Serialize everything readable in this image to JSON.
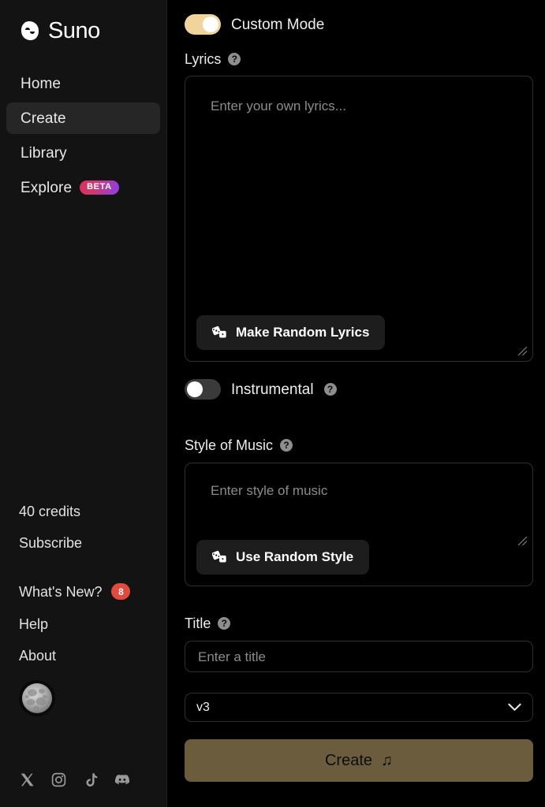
{
  "brand": {
    "name": "Suno",
    "logo_icon": "suno-wave-logo"
  },
  "sidebar": {
    "nav": [
      {
        "label": "Home",
        "icon": "home-nav-item",
        "active": false
      },
      {
        "label": "Create",
        "icon": "create-nav-item",
        "active": true
      },
      {
        "label": "Library",
        "icon": "library-nav-item",
        "active": false
      },
      {
        "label": "Explore",
        "icon": "explore-nav-item",
        "active": false,
        "badge": "BETA"
      }
    ],
    "credits": "40 credits",
    "subscribe": "Subscribe",
    "whats_new": "What's New?",
    "whats_new_count": "8",
    "help": "Help",
    "about": "About",
    "avatar_icon": "moon-avatar",
    "socials": [
      {
        "name": "x-twitter-icon"
      },
      {
        "name": "instagram-icon"
      },
      {
        "name": "tiktok-icon"
      },
      {
        "name": "discord-icon"
      }
    ]
  },
  "main": {
    "custom_mode": {
      "label": "Custom Mode",
      "state": "on"
    },
    "lyrics": {
      "label": "Lyrics",
      "help_icon": "question-mark-icon",
      "placeholder": "Enter your own lyrics...",
      "value": "",
      "random_button": "Make Random Lyrics",
      "random_button_icon": "dice-icon"
    },
    "instrumental": {
      "label": "Instrumental",
      "state": "off",
      "help_icon": "question-mark-icon"
    },
    "style": {
      "label": "Style of Music",
      "help_icon": "question-mark-icon",
      "placeholder": "Enter style of music",
      "value": "",
      "random_button": "Use Random Style",
      "random_button_icon": "dice-icon"
    },
    "title": {
      "label": "Title",
      "help_icon": "question-mark-icon",
      "placeholder": "Enter a title",
      "value": ""
    },
    "version": {
      "selected": "v3",
      "chevron_icon": "chevron-down-icon"
    },
    "create_button": {
      "label": "Create",
      "icon": "music-note-icon"
    }
  },
  "colors": {
    "accent_toggle_on": "#f0d49b",
    "create_button_bg": "#6b5c3e",
    "badge_red": "#e04a3f",
    "beta_gradient_start": "#d6335f",
    "beta_gradient_end": "#8b3fe8",
    "sidebar_bg": "#131313",
    "main_bg": "#000000"
  },
  "help_glyph": "?"
}
